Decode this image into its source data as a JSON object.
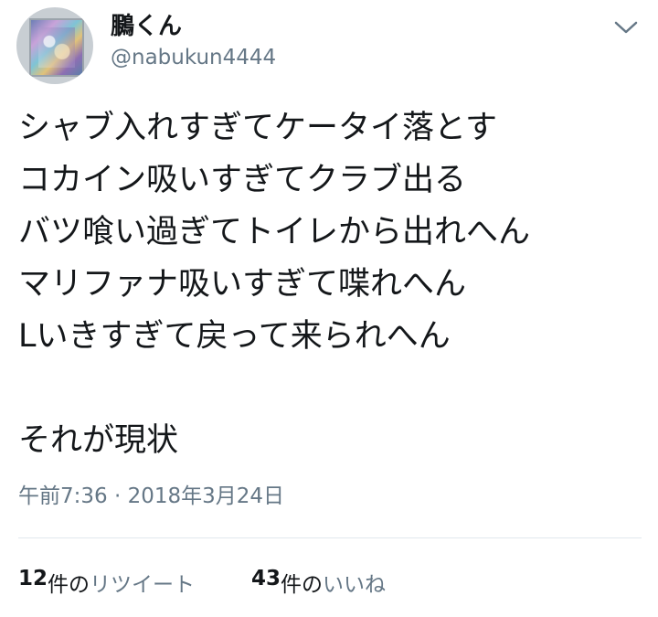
{
  "user": {
    "display_name": "鵩くん",
    "handle": "@nabukun4444"
  },
  "tweet": {
    "lines": [
      "シャブ入れすぎてケータイ落とす",
      "コカイン吸いすぎてクラブ出る",
      "バツ喰い過ぎてトイレから出れへん",
      "マリファナ吸いすぎて喋れへん",
      "Lいきすぎて戻って来られへん",
      "",
      "それが現状"
    ],
    "timestamp": "午前7:36 · 2018年3月24日"
  },
  "stats": {
    "retweets": {
      "count": "12",
      "unit": "件の",
      "label": "リツイート"
    },
    "likes": {
      "count": "43",
      "unit": "件の",
      "label": "いいね"
    }
  },
  "icons": {
    "menu": "chevron-down-icon",
    "avatar": "avatar-image"
  },
  "colors": {
    "text": "#14171a",
    "secondary": "#657786",
    "divider": "#e1e8ed"
  }
}
